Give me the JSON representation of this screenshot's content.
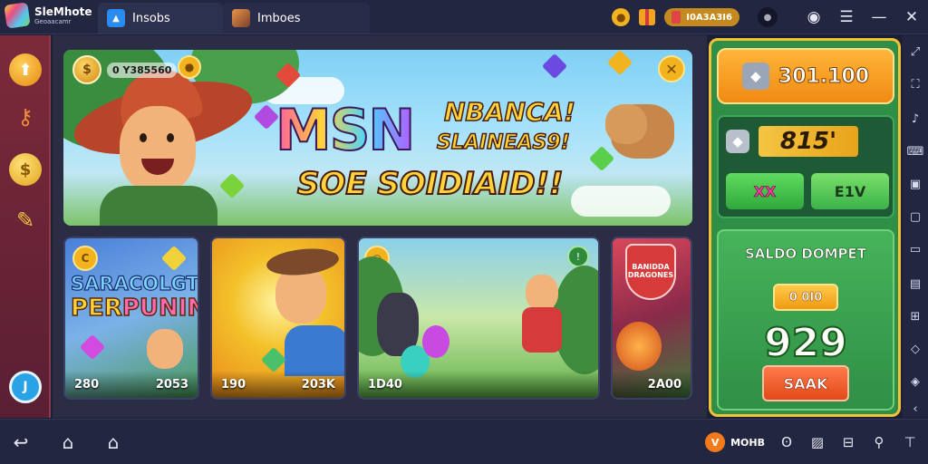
{
  "app": {
    "brand_name": "SleMhote",
    "brand_sub": "Geoaacamr"
  },
  "tabs": [
    {
      "label": "Insobs",
      "icon": "home-icon"
    },
    {
      "label": "Imboes",
      "icon": "game-icon"
    }
  ],
  "titlebar": {
    "pill_text": "I0A3A3I6"
  },
  "leftbar": {
    "bottom_label": "J"
  },
  "hero": {
    "stat": "0 Y385560",
    "title_main": "MSN",
    "title_r1": "NBANCA!",
    "title_r2": "SLAINEAS9!",
    "title_r3": "SOE SOIDIAID!!"
  },
  "cards": [
    {
      "title_1": "SARACOLGTOS",
      "title_2a": "PER",
      "title_2b": "PUNIN",
      "left": "280",
      "right": "2053"
    },
    {
      "left": "190",
      "right": "203K"
    },
    {
      "left": "1D40",
      "right": ""
    },
    {
      "shield": "BANIDDA DRAGONES",
      "left": "",
      "right": "2A00"
    }
  ],
  "rightpanel": {
    "top_value": "301.100",
    "mid_value": "815'",
    "btn_a": "XX",
    "btn_b": "E1V",
    "wallet_title": "SALDO DOMPET",
    "wallet_pill": "0 0I0",
    "wallet_value": "929",
    "wallet_btn": "SAAK"
  },
  "bottombar": {
    "badge_letter": "V",
    "badge_text": "MOHB"
  }
}
